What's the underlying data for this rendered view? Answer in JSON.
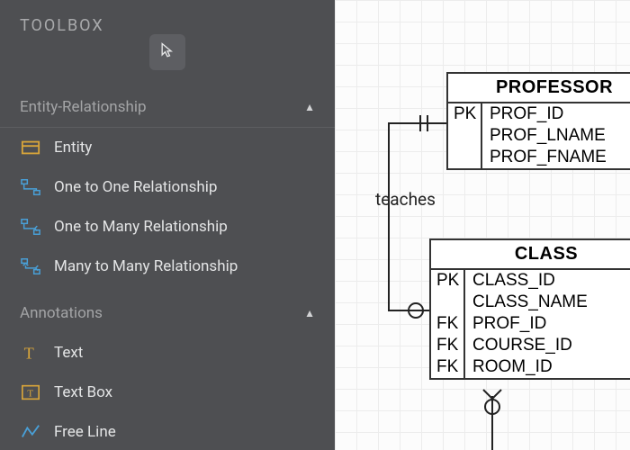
{
  "toolbox": {
    "title": "TOOLBOX",
    "sections": [
      {
        "label": "Entity-Relationship",
        "items": [
          {
            "name": "entity",
            "label": "Entity"
          },
          {
            "name": "one-to-one",
            "label": "One to One Relationship"
          },
          {
            "name": "one-to-many",
            "label": "One to Many Relationship"
          },
          {
            "name": "many-to-many",
            "label": "Many to Many Relationship"
          }
        ]
      },
      {
        "label": "Annotations",
        "items": [
          {
            "name": "text",
            "label": "Text"
          },
          {
            "name": "text-box",
            "label": "Text Box"
          },
          {
            "name": "free-line",
            "label": "Free Line"
          }
        ]
      }
    ]
  },
  "canvas": {
    "relationship_label": "teaches",
    "entities": [
      {
        "id": "professor",
        "title": "PROFESSOR",
        "rows": [
          {
            "key": "PK",
            "attr": "PROF_ID"
          },
          {
            "key": "",
            "attr": "PROF_LNAME"
          },
          {
            "key": "",
            "attr": "PROF_FNAME"
          }
        ]
      },
      {
        "id": "class",
        "title": "CLASS",
        "rows": [
          {
            "key": "PK",
            "attr": "CLASS_ID"
          },
          {
            "key": "",
            "attr": "CLASS_NAME"
          },
          {
            "key": "FK",
            "attr": "PROF_ID"
          },
          {
            "key": "FK",
            "attr": "COURSE_ID"
          },
          {
            "key": "FK",
            "attr": "ROOM_ID"
          }
        ]
      }
    ]
  }
}
